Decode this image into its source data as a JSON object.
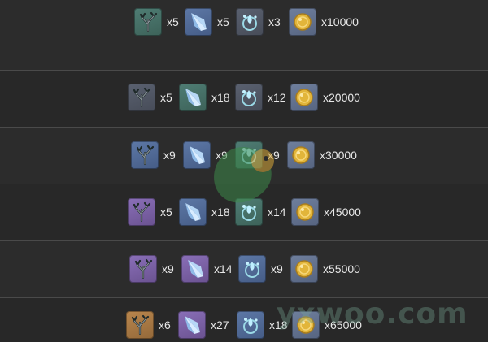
{
  "rows": [
    {
      "materials": [
        {
          "icon": "coral-branch-icon",
          "rarity": "green",
          "qty": "x5"
        },
        {
          "icon": "crystal-shard-icon",
          "rarity": "blue",
          "qty": "x5"
        },
        {
          "icon": "droplet-emblem-icon",
          "rarity": "gray",
          "qty": "x3"
        }
      ],
      "mora": "x10000"
    },
    {
      "materials": [
        {
          "icon": "coral-branch-icon",
          "rarity": "gray",
          "qty": "x5"
        },
        {
          "icon": "crystal-shard-icon",
          "rarity": "green",
          "qty": "x18"
        },
        {
          "icon": "droplet-emblem-icon",
          "rarity": "gray",
          "qty": "x12"
        }
      ],
      "mora": "x20000"
    },
    {
      "materials": [
        {
          "icon": "coral-branch-icon",
          "rarity": "blue",
          "qty": "x9"
        },
        {
          "icon": "crystal-shard-icon",
          "rarity": "blue",
          "qty": "x9"
        },
        {
          "icon": "droplet-emblem-icon",
          "rarity": "green",
          "qty": "x9"
        }
      ],
      "mora": "x30000"
    },
    {
      "materials": [
        {
          "icon": "coral-branch-icon",
          "rarity": "purple",
          "qty": "x5"
        },
        {
          "icon": "crystal-shard-icon",
          "rarity": "blue",
          "qty": "x18"
        },
        {
          "icon": "droplet-emblem-icon",
          "rarity": "green",
          "qty": "x14"
        }
      ],
      "mora": "x45000"
    },
    {
      "materials": [
        {
          "icon": "coral-branch-icon",
          "rarity": "purple",
          "qty": "x9"
        },
        {
          "icon": "crystal-shard-icon",
          "rarity": "purple",
          "qty": "x14"
        },
        {
          "icon": "droplet-emblem-icon",
          "rarity": "blue",
          "qty": "x9"
        }
      ],
      "mora": "x55000"
    },
    {
      "materials": [
        {
          "icon": "coral-branch-icon",
          "rarity": "gold",
          "qty": "x6"
        },
        {
          "icon": "crystal-shard-icon",
          "rarity": "purple",
          "qty": "x27"
        },
        {
          "icon": "droplet-emblem-icon",
          "rarity": "blue",
          "qty": "x18"
        }
      ],
      "mora": "x65000"
    }
  ],
  "mora_icon": "mora-coin-icon",
  "colors": {
    "background": "#2b2b2b",
    "divider": "#4a4a4a",
    "text": "#e8e8e8",
    "rarity_green": "#4f7d74",
    "rarity_blue": "#5d78a6",
    "rarity_purple": "#8a6fb8",
    "rarity_gold": "#b9864d",
    "coin": "#e2b53a"
  },
  "watermark": "yxwoo.com"
}
